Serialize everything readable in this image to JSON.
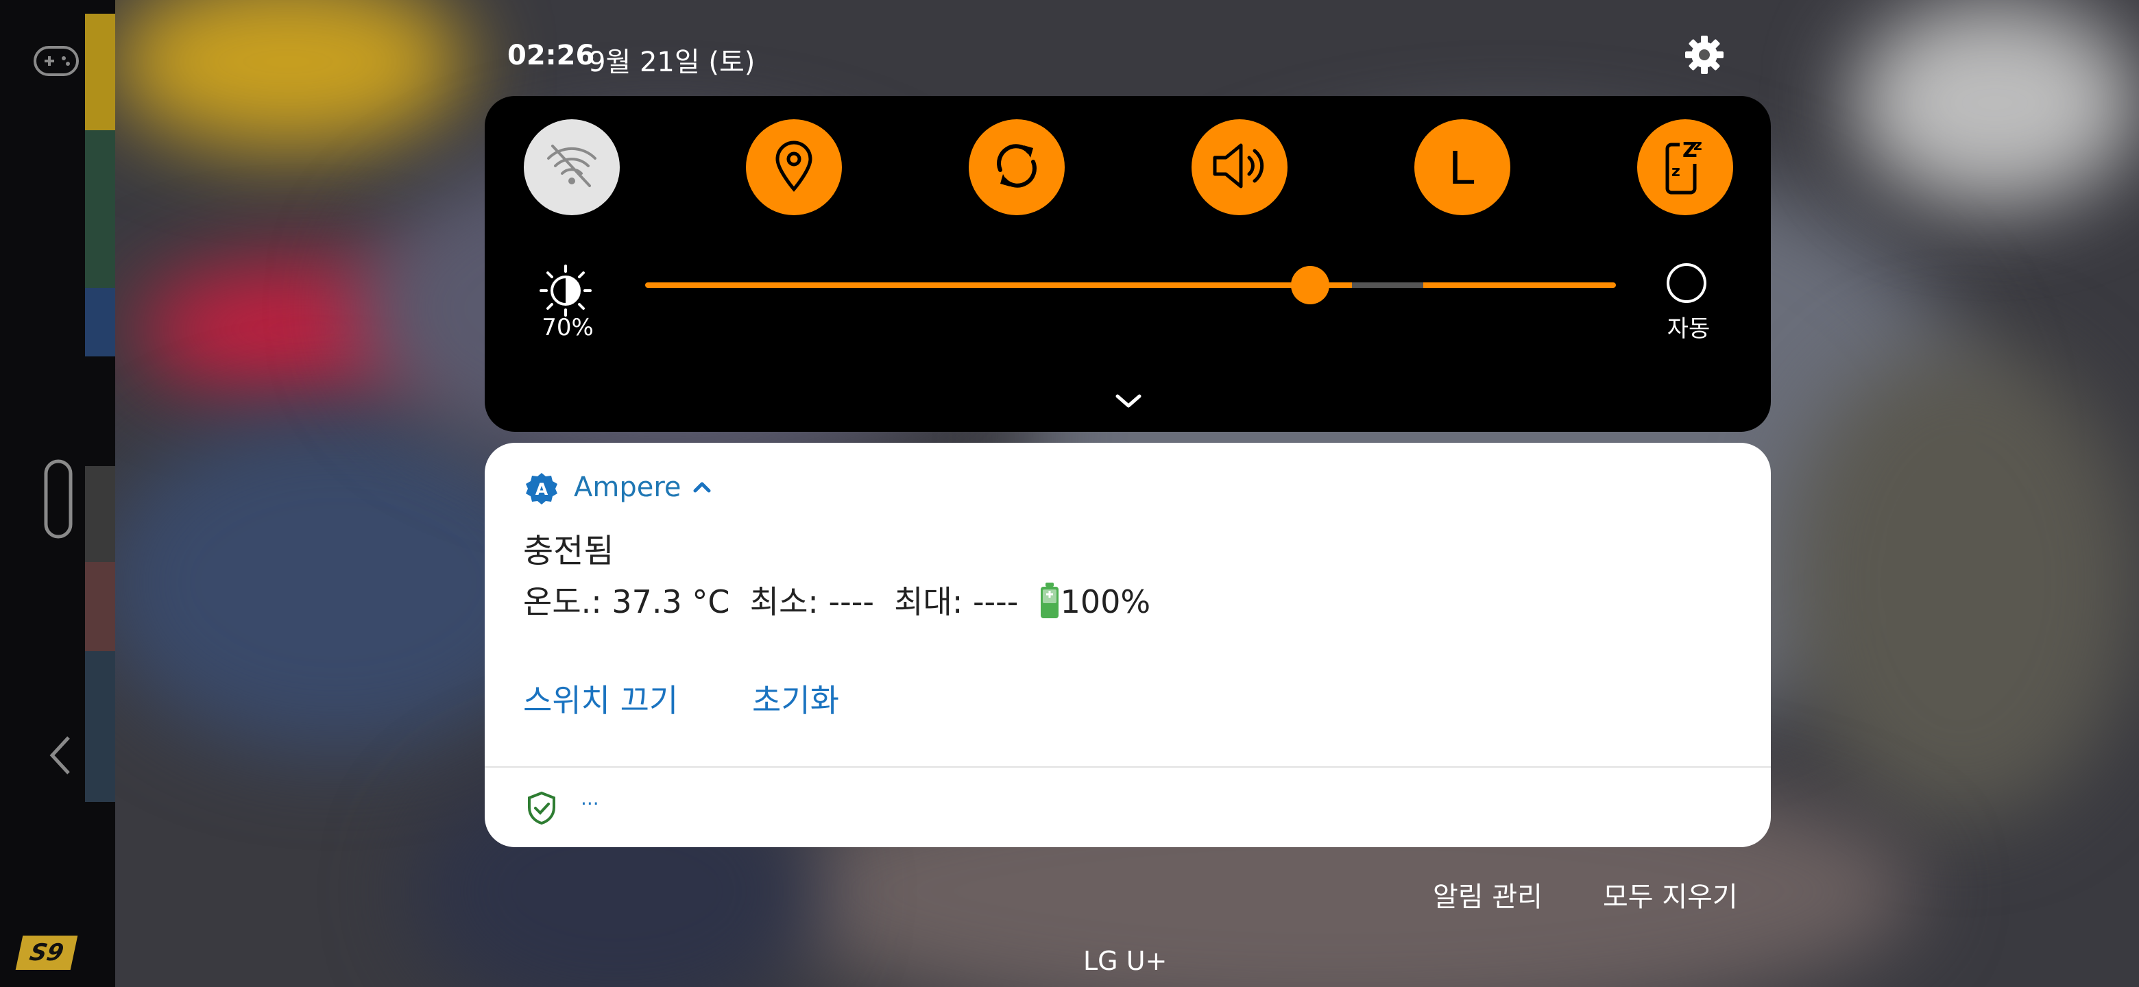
{
  "status": {
    "time": "02:26",
    "date": "9월 21일 (토)"
  },
  "quick_settings": {
    "tiles": [
      {
        "name": "wifi",
        "icon": "wifi-off-icon",
        "state": "off"
      },
      {
        "name": "location",
        "icon": "location-pin-icon",
        "state": "on"
      },
      {
        "name": "auto-rotate",
        "icon": "sync-icon",
        "state": "on"
      },
      {
        "name": "sound",
        "icon": "volume-icon",
        "state": "on"
      },
      {
        "name": "L",
        "icon": "l-letter-icon",
        "state": "on",
        "label": "L"
      },
      {
        "name": "do-not-disturb",
        "icon": "sleep-phone-icon",
        "state": "on"
      }
    ],
    "brightness": {
      "percent_label": "70%",
      "level": 0.7
    },
    "auto_label": "자동"
  },
  "notification": {
    "app_name": "Ampere",
    "title": "충전됨",
    "body_text": "온도.: 37.3 °C  최소: ----  최대: ----  ",
    "battery_pct": "100%",
    "actions": [
      "스위치 끄기",
      "초기화"
    ],
    "secondary_dots": "···"
  },
  "footer": {
    "manage": "알림 관리",
    "clear_all": "모두 지우기",
    "carrier": "LG U+"
  },
  "colors": {
    "accent": "#ff8c00",
    "link": "#1a73c0",
    "panel": "#000000"
  }
}
